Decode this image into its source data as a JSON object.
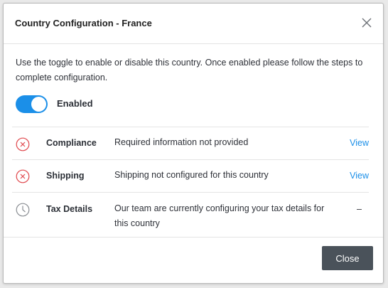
{
  "modal": {
    "title": "Country Configuration - France",
    "description": "Use the toggle to enable or disable this country. Once enabled please follow the steps to complete configuration.",
    "toggle": {
      "label": "Enabled",
      "on": true
    },
    "rows": [
      {
        "icon": "error-circle-x-icon",
        "name": "Compliance",
        "detail": "Required information not provided",
        "action": "View"
      },
      {
        "icon": "error-circle-x-icon",
        "name": "Shipping",
        "detail": "Shipping not configured for this country",
        "action": "View"
      },
      {
        "icon": "clock-icon",
        "name": "Tax Details",
        "detail": "Our team are currently configuring your tax details for this country",
        "action": "–"
      }
    ],
    "close_button": "Close"
  },
  "colors": {
    "accent": "#1b8fe8",
    "error": "#e0474c",
    "button": "#4a525a"
  }
}
